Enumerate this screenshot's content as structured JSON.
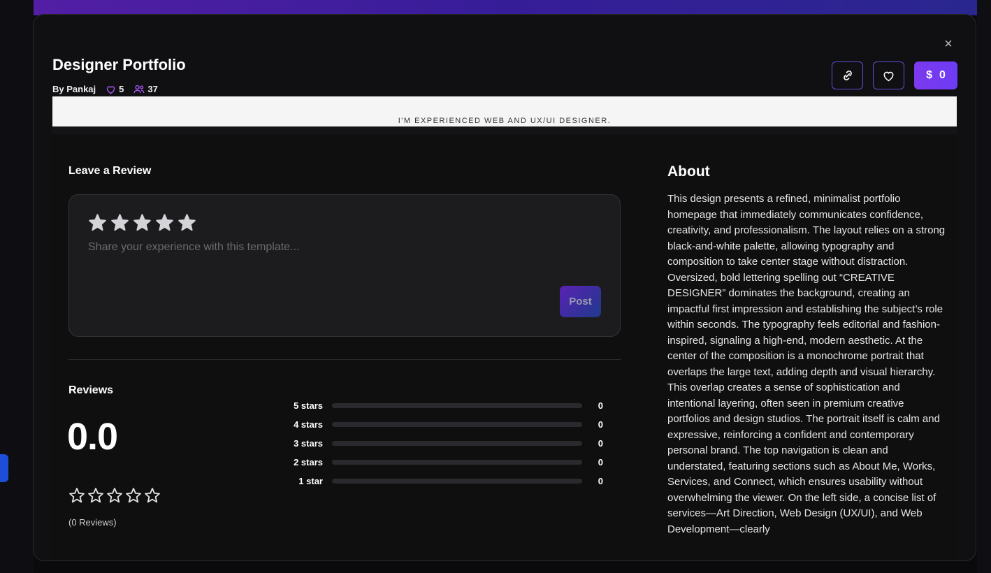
{
  "template": {
    "title": "Designer Portfolio",
    "author": "By Pankaj",
    "likes": "5",
    "users": "37",
    "price": "0",
    "price_symbol": "$",
    "preview_text": "I'M EXPERIENCED WEB AND UX/UI DESIGNER."
  },
  "review_form": {
    "heading": "Leave a Review",
    "placeholder": "Share your experience with this template...",
    "post_label": "Post",
    "rating": 0
  },
  "reviews": {
    "heading": "Reviews",
    "average": "0.0",
    "count_label": "(0 Reviews)",
    "distribution": [
      {
        "label": "5 stars",
        "count": "0",
        "fraction": 0
      },
      {
        "label": "4 stars",
        "count": "0",
        "fraction": 0
      },
      {
        "label": "3 stars",
        "count": "0",
        "fraction": 0
      },
      {
        "label": "2 stars",
        "count": "0",
        "fraction": 0
      },
      {
        "label": "1 star",
        "count": "0",
        "fraction": 0
      }
    ]
  },
  "about": {
    "heading": "About",
    "text": "This design presents a refined, minimalist portfolio homepage that immediately communicates confidence, creativity, and professionalism. The layout relies on a strong black-and-white palette, allowing typography and composition to take center stage without distraction. Oversized, bold lettering spelling out “CREATIVE DESIGNER” dominates the background, creating an impactful first impression and establishing the subject’s role within seconds. The typography feels editorial and fashion-inspired, signaling a high-end, modern aesthetic. At the center of the composition is a monochrome portrait that overlaps the large text, adding depth and visual hierarchy. This overlap creates a sense of sophistication and intentional layering, often seen in premium creative portfolios and design studios. The portrait itself is calm and expressive, reinforcing a confident and contemporary personal brand. The top navigation is clean and understated, featuring sections such as About Me, Works, Services, and Connect, which ensures usability without overwhelming the viewer. On the left side, a concise list of services—Art Direction, Web Design (UX/UI), and Web Development—clearly"
  },
  "colors": {
    "accent": "#7c3aed",
    "border_accent": "#5b4fd8",
    "star_filled": "#d4d4d8"
  },
  "icons": {
    "close": "close-icon",
    "link": "link-icon",
    "heart": "heart-icon",
    "users": "users-icon",
    "star": "star-icon"
  }
}
